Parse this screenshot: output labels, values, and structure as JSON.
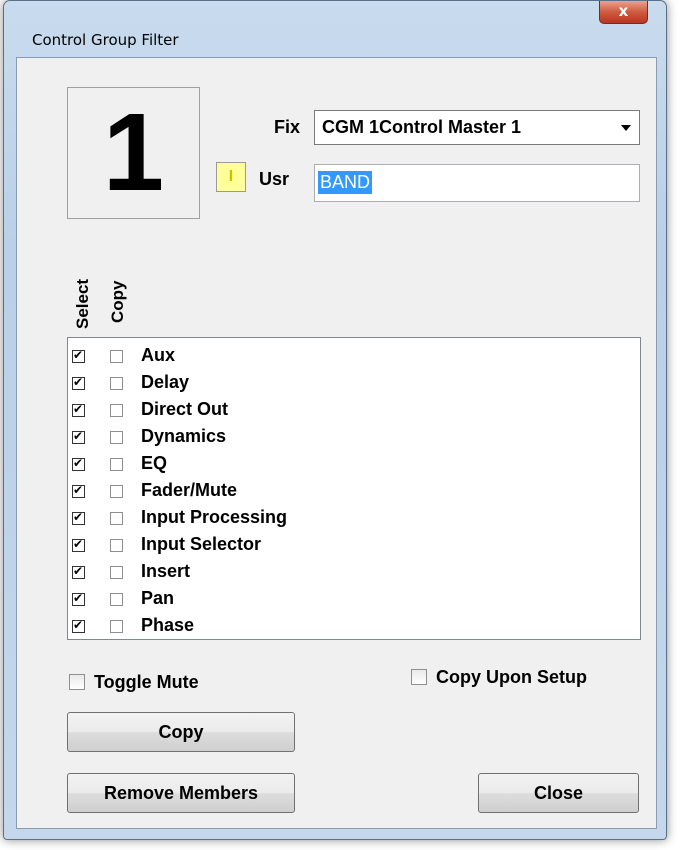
{
  "window": {
    "title": "Control Group Filter",
    "close_glyph": "x"
  },
  "group_number": "1",
  "fix": {
    "label": "Fix",
    "selected": "CGM 1Control Master 1"
  },
  "usr": {
    "button_label": "I",
    "label": "Usr",
    "value": "BAND"
  },
  "columns": {
    "select": "Select",
    "copy": "Copy"
  },
  "items": [
    {
      "label": "Aux",
      "select": true,
      "copy": false
    },
    {
      "label": "Delay",
      "select": true,
      "copy": false
    },
    {
      "label": "Direct Out",
      "select": true,
      "copy": false
    },
    {
      "label": "Dynamics",
      "select": true,
      "copy": false
    },
    {
      "label": "EQ",
      "select": true,
      "copy": false
    },
    {
      "label": "Fader/Mute",
      "select": true,
      "copy": false
    },
    {
      "label": "Input Processing",
      "select": true,
      "copy": false
    },
    {
      "label": "Input Selector",
      "select": true,
      "copy": false
    },
    {
      "label": "Insert",
      "select": true,
      "copy": false
    },
    {
      "label": "Pan",
      "select": true,
      "copy": false
    },
    {
      "label": "Phase",
      "select": true,
      "copy": false
    }
  ],
  "options": {
    "toggle_mute": "Toggle Mute",
    "toggle_mute_checked": false,
    "copy_upon_setup": "Copy Upon Setup",
    "copy_upon_setup_checked": false
  },
  "buttons": {
    "copy": "Copy",
    "remove_members": "Remove Members",
    "close": "Close"
  }
}
